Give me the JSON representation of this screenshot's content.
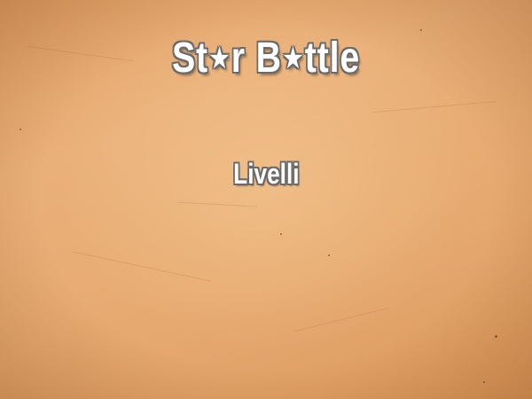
{
  "game": {
    "title_parts": [
      "St",
      "★",
      "r B",
      "★",
      "ttle"
    ]
  },
  "menu": {
    "items": [
      {
        "label": "Livelli"
      }
    ]
  },
  "colors": {
    "background": "#e7ab72",
    "text": "#ffffff",
    "outline": "#6a6a6a"
  }
}
